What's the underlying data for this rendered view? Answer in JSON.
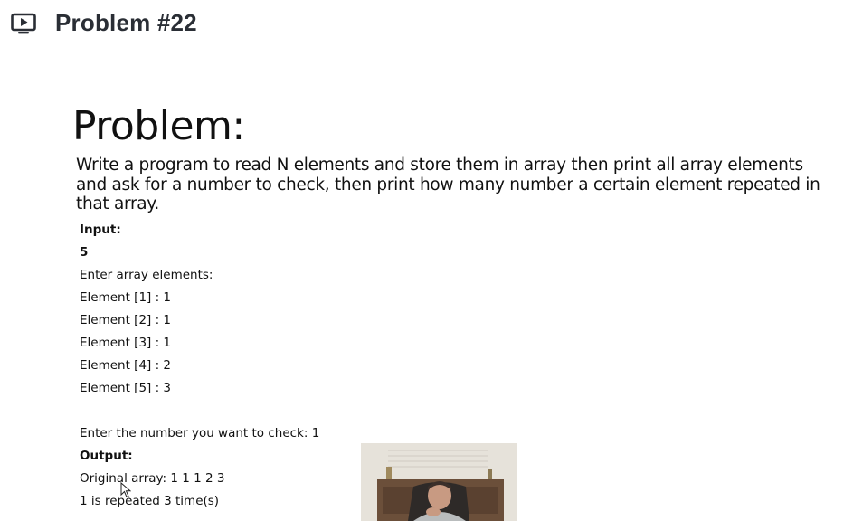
{
  "header": {
    "icon": "video-play-icon",
    "title": "Problem #22"
  },
  "slide": {
    "heading": "Problem:",
    "statement": "Write a program to read N elements and store them in array then print all array elements and ask for a number to check, then print how many number a certain element repeated in that array.",
    "input_label": "Input:",
    "n_value": "5",
    "enter_elements": "Enter array elements:",
    "elements": [
      "Element [1] : 1",
      "Element [2] : 1",
      "Element [3] : 1",
      "Element [4] : 2",
      "Element [5] : 3"
    ],
    "check_prompt": "Enter the number you want to check: 1",
    "output_label": "Output:",
    "original_array": "Original array: 1 1 1 2 3",
    "repeat_result": "1 is repeated 3 time(s)"
  },
  "colors": {
    "title_text": "#2a2e35",
    "slide_text": "#111111",
    "background": "#ffffff"
  }
}
